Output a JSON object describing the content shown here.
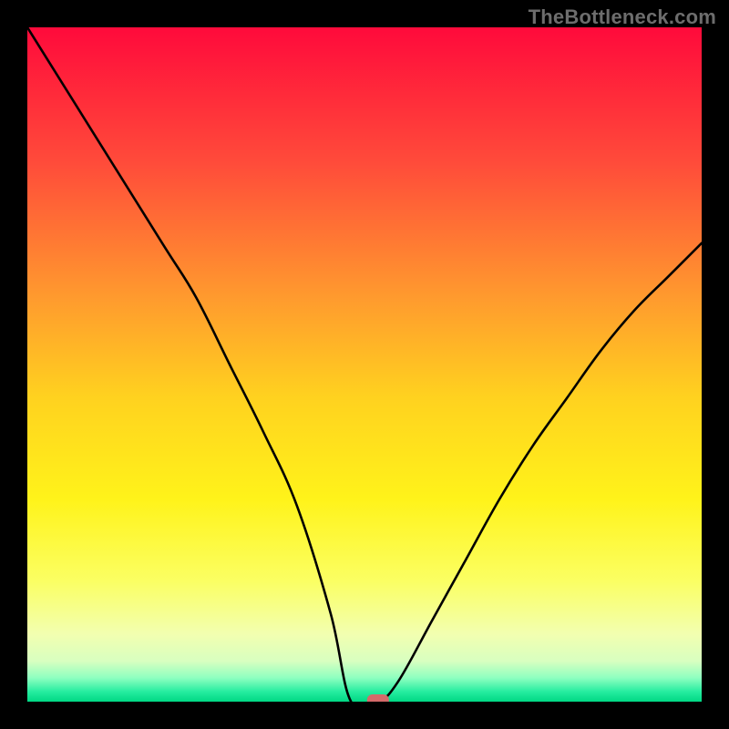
{
  "watermark": "TheBottleneck.com",
  "chart_data": {
    "type": "line",
    "title": "",
    "xlabel": "",
    "ylabel": "",
    "xlim": [
      0,
      100
    ],
    "ylim": [
      0,
      100
    ],
    "grid": false,
    "legend": false,
    "marker": {
      "x": 52,
      "y": 0,
      "color": "#d46a6a"
    },
    "series": [
      {
        "name": "curve",
        "x": [
          0,
          10,
          20,
          25,
          30,
          35,
          40,
          45,
          48,
          52,
          55,
          60,
          65,
          70,
          75,
          80,
          85,
          90,
          95,
          100
        ],
        "y": [
          100,
          84,
          68,
          60,
          50,
          40,
          29,
          13,
          0,
          0,
          3,
          12,
          21,
          30,
          38,
          45,
          52,
          58,
          63,
          68
        ]
      }
    ],
    "background_gradient": {
      "stops": [
        {
          "offset": 0.0,
          "color": "#ff0a3b"
        },
        {
          "offset": 0.2,
          "color": "#ff4b3a"
        },
        {
          "offset": 0.4,
          "color": "#ff9a2e"
        },
        {
          "offset": 0.55,
          "color": "#ffd21f"
        },
        {
          "offset": 0.7,
          "color": "#fff31a"
        },
        {
          "offset": 0.82,
          "color": "#fbff62"
        },
        {
          "offset": 0.9,
          "color": "#f2ffb0"
        },
        {
          "offset": 0.94,
          "color": "#d8ffc0"
        },
        {
          "offset": 0.965,
          "color": "#8dffc0"
        },
        {
          "offset": 0.985,
          "color": "#26eda0"
        },
        {
          "offset": 1.0,
          "color": "#00d884"
        }
      ]
    }
  }
}
